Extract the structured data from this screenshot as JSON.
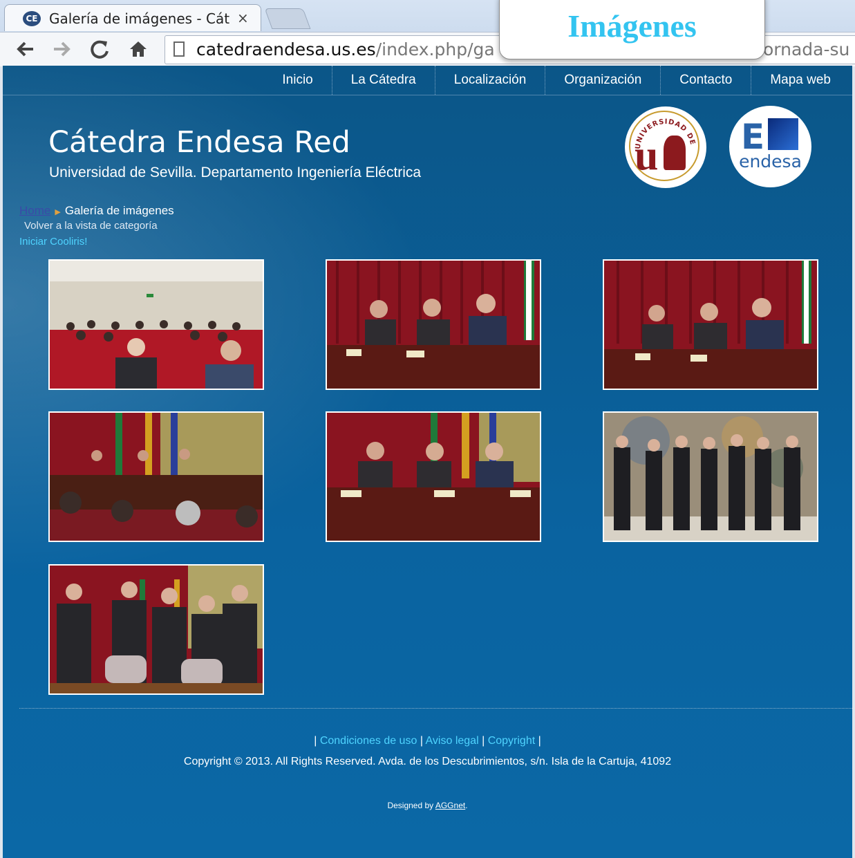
{
  "browser": {
    "tab_title": "Galería de imágenes - Cát",
    "tab_close": "×",
    "favicon_text": "CE",
    "url_domain": "catedraendesa.us.es",
    "url_path": "/index.php/ga",
    "url_tail": "ornada-su",
    "overlay_label": "Imágenes"
  },
  "nav": {
    "items": [
      "Inicio",
      "La Cátedra",
      "Localización",
      "Organización",
      "Contacto",
      "Mapa web"
    ]
  },
  "header": {
    "title": "Cátedra Endesa Red",
    "subtitle": "Universidad de Sevilla. Departamento Ingeniería Eléctrica",
    "logo_us_letter": "u",
    "logo_us_ring_text": "UNIVERSIDAD DE SEVILLA",
    "logo_endesa_letter": "E",
    "logo_endesa_word": "endesa"
  },
  "breadcrumb": {
    "home": "Home",
    "current": "Galería de imágenes"
  },
  "gallery": {
    "back_link": "Volver a la vista de categoría",
    "cooliris": "Iniciar Cooliris!",
    "photos": [
      {
        "scene": "auditorium-audience"
      },
      {
        "scene": "panel-three-men"
      },
      {
        "scene": "panel-three-men"
      },
      {
        "scene": "panel-with-audience"
      },
      {
        "scene": "panel-flags"
      },
      {
        "scene": "group-photo-mural"
      },
      {
        "scene": "group-standing"
      }
    ]
  },
  "footer": {
    "sep": "|",
    "links": [
      "Condiciones de uso",
      "Aviso legal",
      "Copyright"
    ],
    "copyright": "Copyright © 2013. All Rights Reserved. Avda. de los Descubrimientos, s/n. Isla de la Cartuja, 41092",
    "designed_by_prefix": "Designed by",
    "designed_by_link": "AGGnet",
    "designed_by_suffix": "."
  }
}
